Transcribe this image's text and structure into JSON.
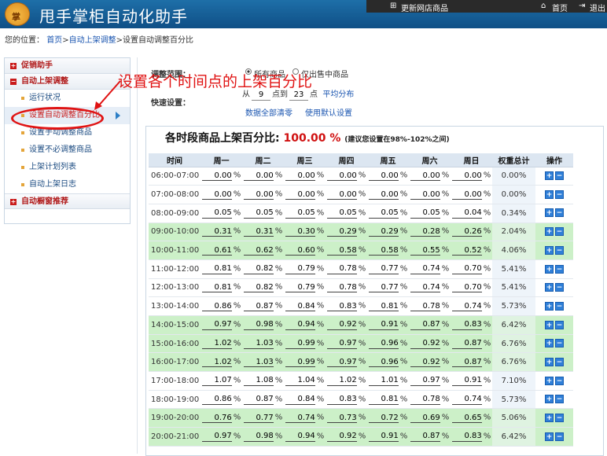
{
  "app": {
    "title": "甩手掌柜自动化助手",
    "logo_text": "掌"
  },
  "topbar": {
    "update_label": "更新网店商品",
    "home_label": "首页",
    "logout_label": "退出"
  },
  "breadcrumb": {
    "prefix": "您的位置：",
    "home": "首页",
    "sep": ">",
    "section": "自动上架调整",
    "current": ">设置自动调整百分比"
  },
  "sidebar": {
    "group1": "促销助手",
    "group2": "自动上架调整",
    "group3": "自动橱窗推荐",
    "items": [
      "运行状况",
      "设置自动调整百分比",
      "设置手动调整商品",
      "设置不必调整商品",
      "上架计划列表",
      "自动上架日志"
    ]
  },
  "annotation": {
    "text": "设置各个时间点的上架百分比",
    "color": "#e01212"
  },
  "settings": {
    "range_label": "调整范围：",
    "radio_all": "所有商品",
    "radio_selected": "仅出售中商品",
    "quick_label": "快速设置：",
    "from": "从",
    "from_val": "9",
    "point1": "点到",
    "to_val": "23",
    "point2": "点",
    "even": "平均分布",
    "clear_all": "数据全部清零",
    "use_default": "使用默认设置"
  },
  "table": {
    "title": "各时段商品上架百分比:",
    "total": "100.00",
    "percent_unit": "%",
    "note": "(建议您设置在98%-102%之间)",
    "headers": [
      "时间",
      "周一",
      "周二",
      "周三",
      "周四",
      "周五",
      "周六",
      "周日",
      "权重总计",
      "操作"
    ],
    "rows": [
      {
        "time": "06:00-07:00",
        "vals": [
          "0.00",
          "0.00",
          "0.00",
          "0.00",
          "0.00",
          "0.00",
          "0.00"
        ],
        "total": "0.00%",
        "hl": false
      },
      {
        "time": "07:00-08:00",
        "vals": [
          "0.00",
          "0.00",
          "0.00",
          "0.00",
          "0.00",
          "0.00",
          "0.00"
        ],
        "total": "0.00%",
        "hl": false
      },
      {
        "time": "08:00-09:00",
        "vals": [
          "0.05",
          "0.05",
          "0.05",
          "0.05",
          "0.05",
          "0.05",
          "0.04"
        ],
        "total": "0.34%",
        "hl": false
      },
      {
        "time": "09:00-10:00",
        "vals": [
          "0.31",
          "0.31",
          "0.30",
          "0.29",
          "0.29",
          "0.28",
          "0.26"
        ],
        "total": "2.04%",
        "hl": true
      },
      {
        "time": "10:00-11:00",
        "vals": [
          "0.61",
          "0.62",
          "0.60",
          "0.58",
          "0.58",
          "0.55",
          "0.52"
        ],
        "total": "4.06%",
        "hl": true
      },
      {
        "time": "11:00-12:00",
        "vals": [
          "0.81",
          "0.82",
          "0.79",
          "0.78",
          "0.77",
          "0.74",
          "0.70"
        ],
        "total": "5.41%",
        "hl": false
      },
      {
        "time": "12:00-13:00",
        "vals": [
          "0.81",
          "0.82",
          "0.79",
          "0.78",
          "0.77",
          "0.74",
          "0.70"
        ],
        "total": "5.41%",
        "hl": false
      },
      {
        "time": "13:00-14:00",
        "vals": [
          "0.86",
          "0.87",
          "0.84",
          "0.83",
          "0.81",
          "0.78",
          "0.74"
        ],
        "total": "5.73%",
        "hl": false
      },
      {
        "time": "14:00-15:00",
        "vals": [
          "0.97",
          "0.98",
          "0.94",
          "0.92",
          "0.91",
          "0.87",
          "0.83"
        ],
        "total": "6.42%",
        "hl": true
      },
      {
        "time": "15:00-16:00",
        "vals": [
          "1.02",
          "1.03",
          "0.99",
          "0.97",
          "0.96",
          "0.92",
          "0.87"
        ],
        "total": "6.76%",
        "hl": true
      },
      {
        "time": "16:00-17:00",
        "vals": [
          "1.02",
          "1.03",
          "0.99",
          "0.97",
          "0.96",
          "0.92",
          "0.87"
        ],
        "total": "6.76%",
        "hl": true
      },
      {
        "time": "17:00-18:00",
        "vals": [
          "1.07",
          "1.08",
          "1.04",
          "1.02",
          "1.01",
          "0.97",
          "0.91"
        ],
        "total": "7.10%",
        "hl": false
      },
      {
        "time": "18:00-19:00",
        "vals": [
          "0.86",
          "0.87",
          "0.84",
          "0.83",
          "0.81",
          "0.78",
          "0.74"
        ],
        "total": "5.73%",
        "hl": false
      },
      {
        "time": "19:00-20:00",
        "vals": [
          "0.76",
          "0.77",
          "0.74",
          "0.73",
          "0.72",
          "0.69",
          "0.65"
        ],
        "total": "5.06%",
        "hl": true
      },
      {
        "time": "20:00-21:00",
        "vals": [
          "0.97",
          "0.98",
          "0.94",
          "0.92",
          "0.91",
          "0.87",
          "0.83"
        ],
        "total": "6.42%",
        "hl": true
      }
    ],
    "plus_icon": "+",
    "minus_icon": "−"
  }
}
